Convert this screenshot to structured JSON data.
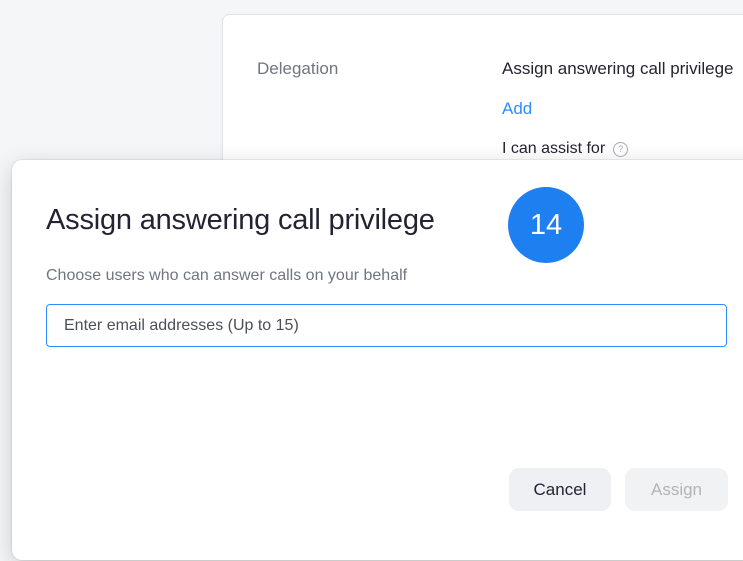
{
  "background_panel": {
    "section_label": "Delegation",
    "setting_title": "Assign answering call privilege",
    "add_link": "Add",
    "assist_label": "I can assist for",
    "help_icon": "?"
  },
  "dialog": {
    "title": "Assign answering call privilege",
    "step_badge": "14",
    "description": "Choose users who can answer calls on your behalf",
    "email_input": {
      "value": "",
      "placeholder": "Enter email addresses (Up to 15)"
    },
    "cancel_label": "Cancel",
    "assign_label": "Assign"
  },
  "colors": {
    "accent": "#2d8cff",
    "badge": "#1e7ff0",
    "disabled_text": "#b0b4bb"
  }
}
